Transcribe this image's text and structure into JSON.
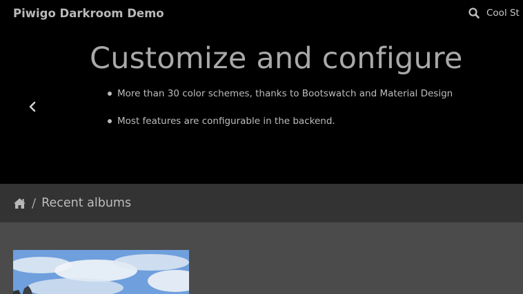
{
  "header": {
    "brand": "Piwigo Darkroom Demo",
    "nav_link": "Cool St",
    "icons": {
      "search": "search-icon"
    }
  },
  "carousel": {
    "title": "Customize and configure",
    "bullets": [
      "More than 30 color schemes, thanks to Bootswatch and Material Design",
      "Most features are configurable in the backend."
    ],
    "icons": {
      "prev": "chevron-left-icon"
    }
  },
  "breadcrumb": {
    "separator": "/",
    "current": "Recent albums",
    "icons": {
      "home": "home-icon"
    }
  },
  "content": {
    "thumbnail": "album-thumbnail"
  },
  "colors": {
    "navbar_bg": "#000000",
    "breadcrumb_bg": "#333333",
    "content_bg": "#4b4b4b",
    "text_muted": "#a9a9a9"
  }
}
